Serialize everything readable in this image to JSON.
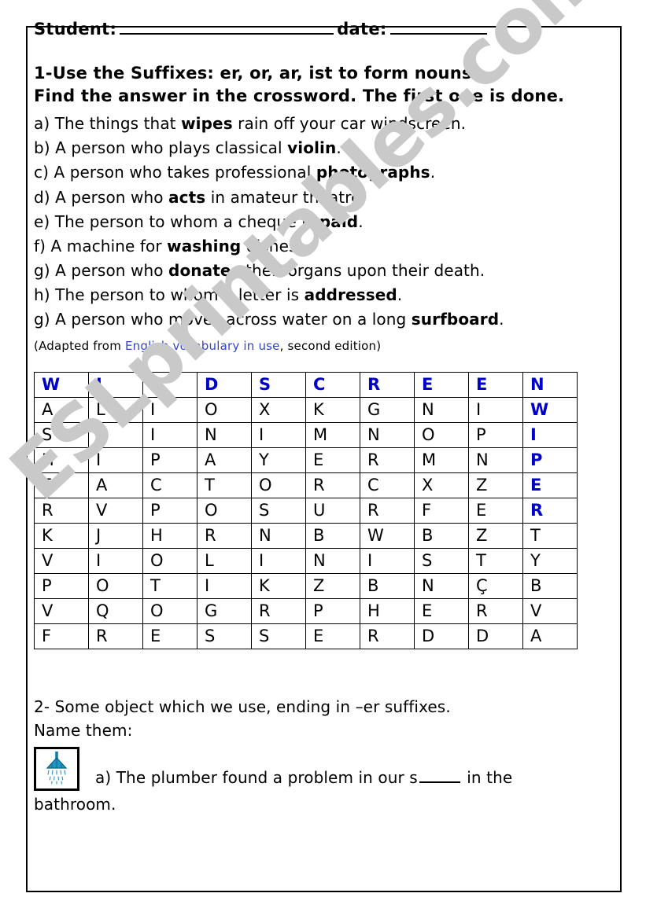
{
  "document": {
    "type": "esl-worksheet",
    "watermark": "ESLprintables.com",
    "colors": {
      "highlight": "#0000cc",
      "source_link": "#3344cc",
      "watermark": "#c9c9c9",
      "ink": "#000000"
    }
  },
  "header": {
    "student_label": "Student:",
    "student_value": "",
    "date_label": "date:",
    "date_value": ""
  },
  "exercise1": {
    "instruction_line1": "1-Use the Suffixes: er, or, ar, ist to form nouns.",
    "instruction_line2": "Find the answer in the crossword. The first one is done.",
    "questions": [
      {
        "marker": "a)",
        "pre": "The things that ",
        "bold": "wipes",
        "post": " rain off your car windscreen."
      },
      {
        "marker": "b)",
        "pre": "A person who plays classical ",
        "bold": "violin",
        "post": "."
      },
      {
        "marker": "c)",
        "pre": "A person who takes professional ",
        "bold": "photographs",
        "post": "."
      },
      {
        "marker": "d)",
        "pre": "A person who ",
        "bold": "acts",
        "post": " in amateur theatre."
      },
      {
        "marker": "e)",
        "pre": "The person to whom a cheque is ",
        "bold": "paid",
        "post": "."
      },
      {
        "marker": "f)",
        "pre": "A machine for ",
        "bold": "washing",
        "post": " dishes."
      },
      {
        "marker": "g)",
        "pre": "A person who ",
        "bold": "donates",
        "post": " their organs upon their death."
      },
      {
        "marker": "h)",
        "pre": "The person to whom a letter is ",
        "bold": "addressed",
        "post": "."
      },
      {
        "marker": "g)",
        "pre": "A person who moves across water on a long ",
        "bold": "surfboard",
        "post": "."
      }
    ],
    "source": {
      "open_paren": "(",
      "prefix": "Adapted from ",
      "title": "English vocabulary in use",
      "suffix": ", second edition",
      "close_paren": ")"
    }
  },
  "wordsearch": {
    "columns": 10,
    "rows": 11,
    "answer_shown": "WINDSCREEN",
    "grid": [
      [
        {
          "letter": "W",
          "highlighted": true
        },
        {
          "letter": "I",
          "highlighted": true
        },
        {
          "letter": "N",
          "highlighted": true
        },
        {
          "letter": "D",
          "highlighted": true
        },
        {
          "letter": "S",
          "highlighted": true
        },
        {
          "letter": "C",
          "highlighted": true
        },
        {
          "letter": "R",
          "highlighted": true
        },
        {
          "letter": "E",
          "highlighted": true
        },
        {
          "letter": "E",
          "highlighted": true
        },
        {
          "letter": "N",
          "highlighted": true
        }
      ],
      [
        {
          "letter": "A",
          "highlighted": false
        },
        {
          "letter": "L",
          "highlighted": false
        },
        {
          "letter": "I",
          "highlighted": false
        },
        {
          "letter": "O",
          "highlighted": false
        },
        {
          "letter": "X",
          "highlighted": false
        },
        {
          "letter": "K",
          "highlighted": false
        },
        {
          "letter": "G",
          "highlighted": false
        },
        {
          "letter": "N",
          "highlighted": false
        },
        {
          "letter": "I",
          "highlighted": false
        },
        {
          "letter": "W",
          "highlighted": true
        }
      ],
      [
        {
          "letter": "S",
          "highlighted": false
        },
        {
          "letter": "S",
          "highlighted": false
        },
        {
          "letter": "I",
          "highlighted": false
        },
        {
          "letter": "N",
          "highlighted": false
        },
        {
          "letter": "I",
          "highlighted": false
        },
        {
          "letter": "M",
          "highlighted": false
        },
        {
          "letter": "N",
          "highlighted": false
        },
        {
          "letter": "O",
          "highlighted": false
        },
        {
          "letter": "P",
          "highlighted": false
        },
        {
          "letter": "I",
          "highlighted": true
        }
      ],
      [
        {
          "letter": "H",
          "highlighted": false
        },
        {
          "letter": "I",
          "highlighted": false
        },
        {
          "letter": "P",
          "highlighted": false
        },
        {
          "letter": "A",
          "highlighted": false
        },
        {
          "letter": "Y",
          "highlighted": false
        },
        {
          "letter": "E",
          "highlighted": false
        },
        {
          "letter": "R",
          "highlighted": false
        },
        {
          "letter": "M",
          "highlighted": false
        },
        {
          "letter": "N",
          "highlighted": false
        },
        {
          "letter": "P",
          "highlighted": true
        }
      ],
      [
        {
          "letter": "E",
          "highlighted": false
        },
        {
          "letter": "A",
          "highlighted": false
        },
        {
          "letter": "C",
          "highlighted": false
        },
        {
          "letter": "T",
          "highlighted": false
        },
        {
          "letter": "O",
          "highlighted": false
        },
        {
          "letter": "R",
          "highlighted": false
        },
        {
          "letter": "C",
          "highlighted": false
        },
        {
          "letter": "X",
          "highlighted": false
        },
        {
          "letter": "Z",
          "highlighted": false
        },
        {
          "letter": "E",
          "highlighted": true
        }
      ],
      [
        {
          "letter": "R",
          "highlighted": false
        },
        {
          "letter": "V",
          "highlighted": false
        },
        {
          "letter": "P",
          "highlighted": false
        },
        {
          "letter": "O",
          "highlighted": false
        },
        {
          "letter": "S",
          "highlighted": false
        },
        {
          "letter": "U",
          "highlighted": false
        },
        {
          "letter": "R",
          "highlighted": false
        },
        {
          "letter": "F",
          "highlighted": false
        },
        {
          "letter": "E",
          "highlighted": false
        },
        {
          "letter": "R",
          "highlighted": true
        }
      ],
      [
        {
          "letter": "K",
          "highlighted": false
        },
        {
          "letter": "J",
          "highlighted": false
        },
        {
          "letter": "H",
          "highlighted": false
        },
        {
          "letter": "R",
          "highlighted": false
        },
        {
          "letter": "N",
          "highlighted": false
        },
        {
          "letter": "B",
          "highlighted": false
        },
        {
          "letter": "W",
          "highlighted": false
        },
        {
          "letter": "B",
          "highlighted": false
        },
        {
          "letter": "Z",
          "highlighted": false
        },
        {
          "letter": "T",
          "highlighted": false
        }
      ],
      [
        {
          "letter": "V",
          "highlighted": false
        },
        {
          "letter": "I",
          "highlighted": false
        },
        {
          "letter": "O",
          "highlighted": false
        },
        {
          "letter": "L",
          "highlighted": false
        },
        {
          "letter": "I",
          "highlighted": false
        },
        {
          "letter": "N",
          "highlighted": false
        },
        {
          "letter": "I",
          "highlighted": false
        },
        {
          "letter": "S",
          "highlighted": false
        },
        {
          "letter": "T",
          "highlighted": false
        },
        {
          "letter": "Y",
          "highlighted": false
        }
      ],
      [
        {
          "letter": "P",
          "highlighted": false
        },
        {
          "letter": "O",
          "highlighted": false
        },
        {
          "letter": "T",
          "highlighted": false
        },
        {
          "letter": "I",
          "highlighted": false
        },
        {
          "letter": "K",
          "highlighted": false
        },
        {
          "letter": "Z",
          "highlighted": false
        },
        {
          "letter": "B",
          "highlighted": false
        },
        {
          "letter": "N",
          "highlighted": false
        },
        {
          "letter": "Ç",
          "highlighted": false
        },
        {
          "letter": "B",
          "highlighted": false
        }
      ],
      [
        {
          "letter": "V",
          "highlighted": false
        },
        {
          "letter": "Q",
          "highlighted": false
        },
        {
          "letter": "O",
          "highlighted": false
        },
        {
          "letter": "G",
          "highlighted": false
        },
        {
          "letter": "R",
          "highlighted": false
        },
        {
          "letter": "P",
          "highlighted": false
        },
        {
          "letter": "H",
          "highlighted": false
        },
        {
          "letter": "E",
          "highlighted": false
        },
        {
          "letter": "R",
          "highlighted": false
        },
        {
          "letter": "V",
          "highlighted": false
        }
      ],
      [
        {
          "letter": "F",
          "highlighted": false
        },
        {
          "letter": "R",
          "highlighted": false
        },
        {
          "letter": "E",
          "highlighted": false
        },
        {
          "letter": "S",
          "highlighted": false
        },
        {
          "letter": "S",
          "highlighted": false
        },
        {
          "letter": "E",
          "highlighted": false
        },
        {
          "letter": "R",
          "highlighted": false
        },
        {
          "letter": "D",
          "highlighted": false
        },
        {
          "letter": "D",
          "highlighted": false
        },
        {
          "letter": "A",
          "highlighted": false
        }
      ]
    ]
  },
  "exercise2": {
    "instruction_line1": "2- Some object which we use, ending in –er suffixes.",
    "instruction_line2": "Name them:",
    "item_a": {
      "icon": "shower-icon",
      "marker": "a)",
      "pre": "The plumber found a problem in our s",
      "blank": "____",
      "post": " in the",
      "tail": "bathroom."
    }
  }
}
